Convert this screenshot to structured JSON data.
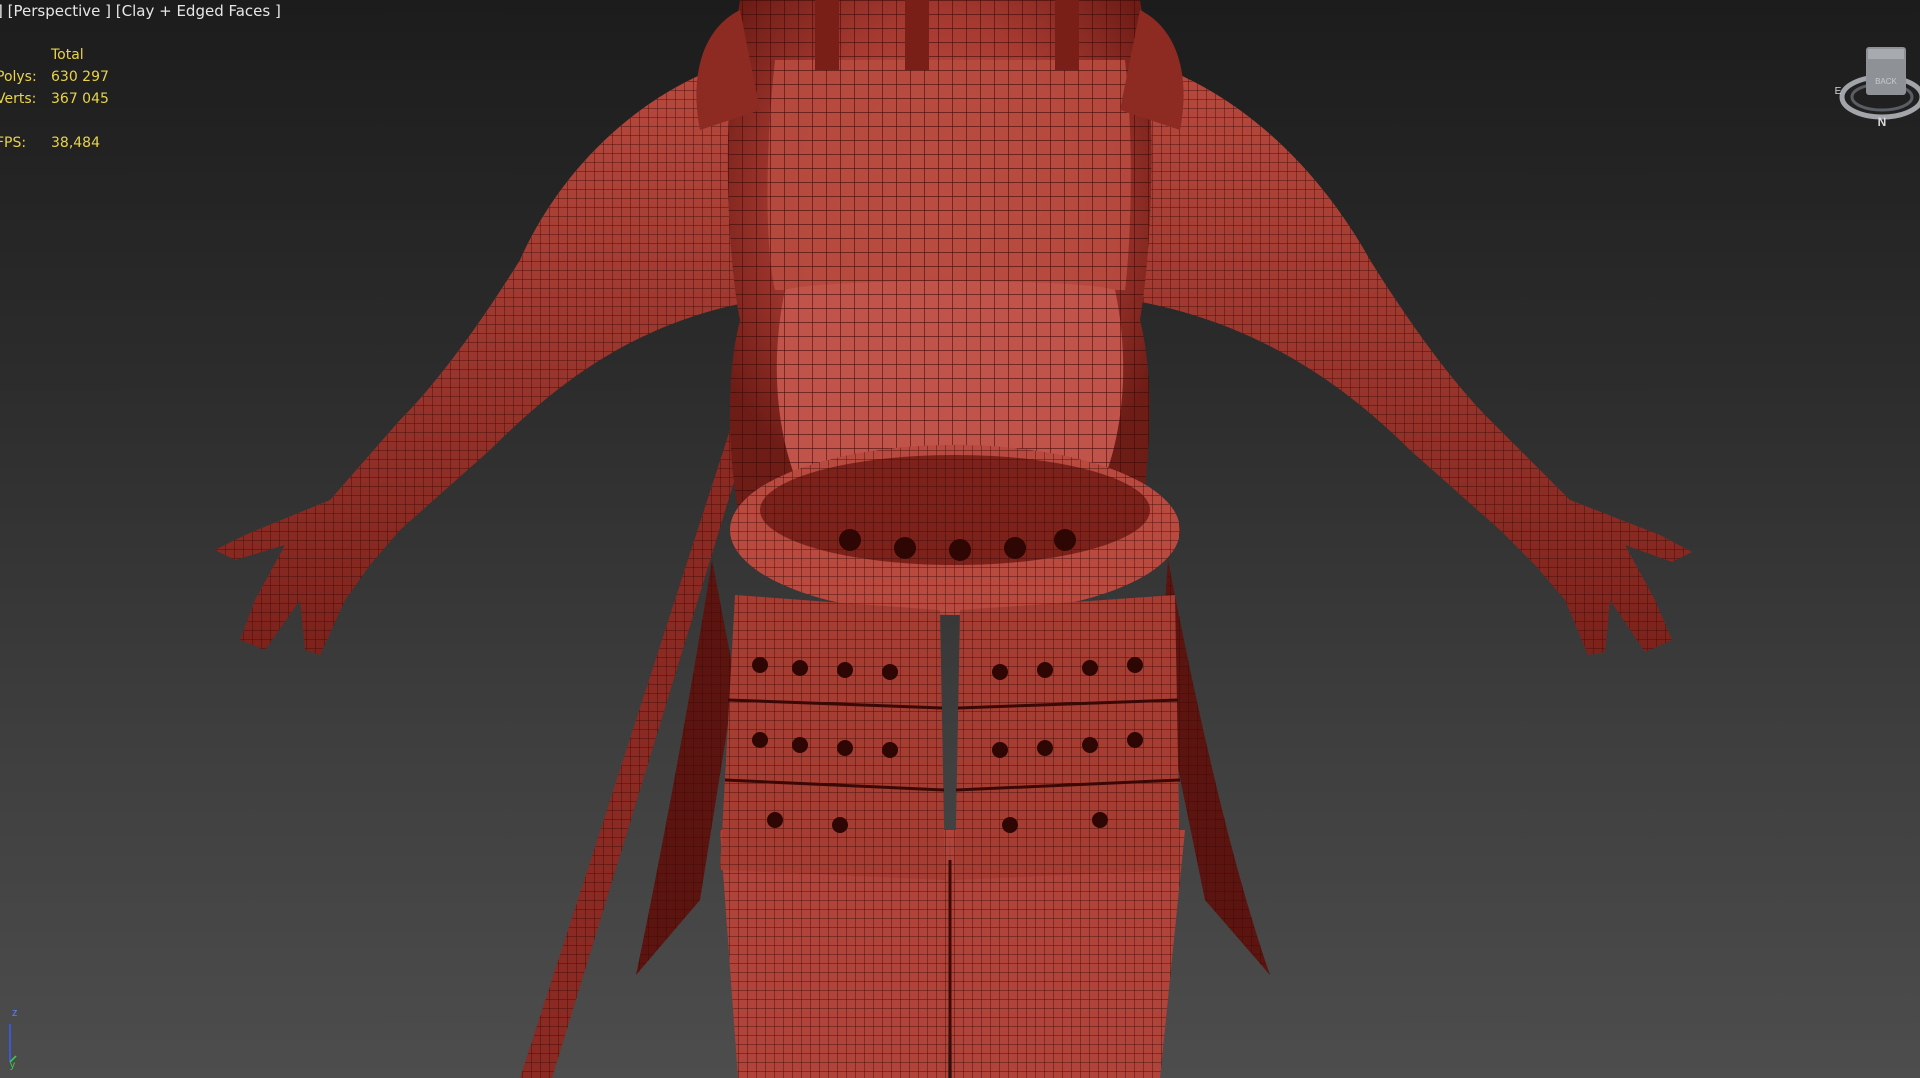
{
  "viewport": {
    "label_bracket": "]",
    "label_view": "[Perspective ]",
    "label_shading": "[Clay + Edged Faces ]"
  },
  "stats": {
    "header": "Total",
    "polys_label": "Polys:",
    "polys_value": "630 297",
    "verts_label": "Verts:",
    "verts_value": "367 045",
    "fps_label": "FPS:",
    "fps_value": "38,484"
  },
  "viewcube": {
    "face_label": "BACK",
    "compass_north": "N",
    "compass_west": "E"
  },
  "axis": {
    "z_label": "z",
    "y_label": "y"
  },
  "colors": {
    "model_red": "#b8453c",
    "model_dark": "#4a0f0c",
    "stats_yellow": "#e8d34a",
    "label_text": "#e6e6e6"
  },
  "icons": {
    "viewcube": "viewcube-icon",
    "axis": "axis-tripod-icon"
  }
}
